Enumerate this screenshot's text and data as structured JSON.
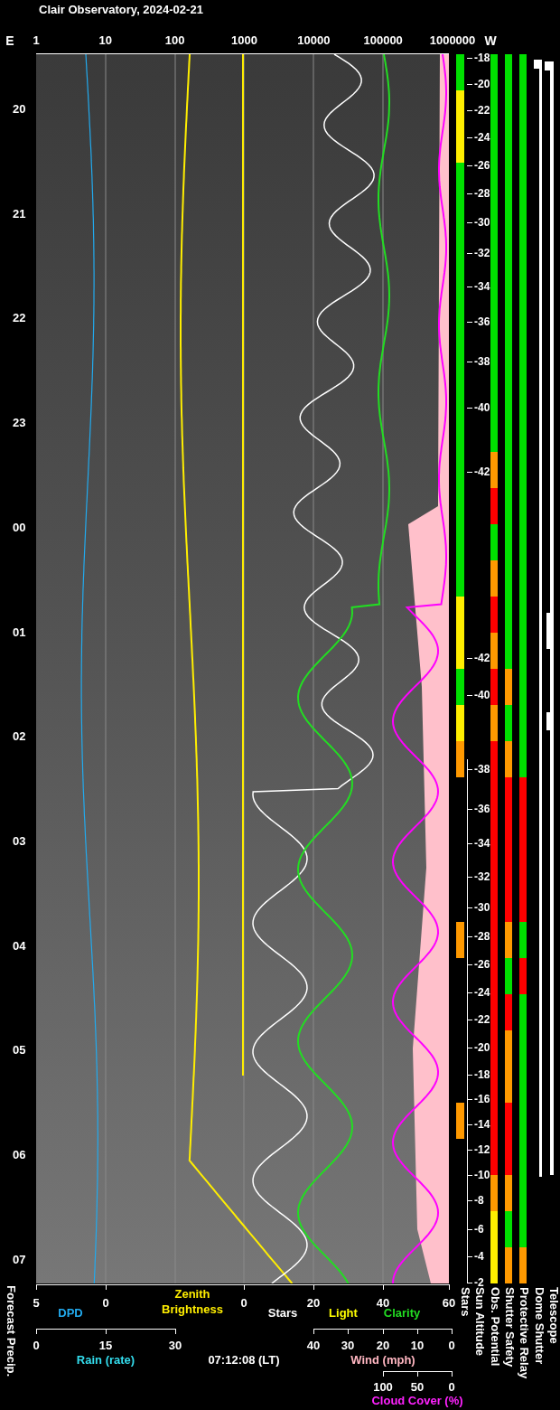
{
  "title": "Clair Observatory, 2024-02-21",
  "top_axis": {
    "left_label": "E",
    "ticks": [
      "1",
      "10",
      "100",
      "1000",
      "10000",
      "100000",
      "1000000"
    ],
    "right_label": "W"
  },
  "time_labels": [
    "20",
    "21",
    "22",
    "23",
    "00",
    "01",
    "02",
    "03",
    "04",
    "05",
    "06",
    "07"
  ],
  "sun_altitude_labels": [
    "-18",
    "-20",
    "-22",
    "-24",
    "-26",
    "-28",
    "-30",
    "-32",
    "-34",
    "-36",
    "-38",
    "-40",
    "-42",
    "-42",
    "-40",
    "-38",
    "-36",
    "-34",
    "-32",
    "-30",
    "-28",
    "-26",
    "-24",
    "-22",
    "-20",
    "-18",
    "-16",
    "-14",
    "-12",
    "-10",
    "-8",
    "-6",
    "-4",
    "-2"
  ],
  "status_bars": [
    {
      "slots": [
        {
          "active": true,
          "color": "#00e000"
        },
        {
          "active": true,
          "color": "#ffee00"
        },
        {
          "active": true,
          "color": "#ffee00"
        },
        {
          "active": true,
          "color": "#00e000"
        },
        {
          "active": true,
          "color": "#00e000"
        },
        {
          "active": true,
          "color": "#00e000"
        },
        {
          "active": true,
          "color": "#00e000"
        },
        {
          "active": true,
          "color": "#00e000"
        },
        {
          "active": true,
          "color": "#00e000"
        },
        {
          "active": true,
          "color": "#00e000"
        },
        {
          "active": true,
          "color": "#00e000"
        },
        {
          "active": true,
          "color": "#00e000"
        },
        {
          "active": true,
          "color": "#00e000"
        },
        {
          "active": true,
          "color": "#00e000"
        },
        {
          "active": true,
          "color": "#00e000"
        },
        {
          "active": true,
          "color": "#ffee00"
        },
        {
          "active": true,
          "color": "#ffee00"
        },
        {
          "active": true,
          "color": "#00e000"
        },
        {
          "active": true,
          "color": "#ffee00"
        },
        {
          "active": true,
          "color": "#ff9900"
        },
        {
          "active": false
        },
        {
          "active": false
        },
        {
          "active": false
        },
        {
          "active": false
        },
        {
          "active": true,
          "color": "#ff9900"
        },
        {
          "active": false
        },
        {
          "active": false
        },
        {
          "active": false
        },
        {
          "active": false
        },
        {
          "active": true,
          "color": "#ff9900"
        },
        {
          "active": false
        },
        {
          "active": false
        },
        {
          "active": false
        },
        {
          "active": false
        }
      ]
    },
    {
      "slots": [
        {
          "color": "#00e000"
        },
        {
          "color": "#00e000"
        },
        {
          "color": "#00e000"
        },
        {
          "color": "#00e000"
        },
        {
          "color": "#00e000"
        },
        {
          "color": "#00e000"
        },
        {
          "color": "#00e000"
        },
        {
          "color": "#00e000"
        },
        {
          "color": "#00e000"
        },
        {
          "color": "#00e000"
        },
        {
          "color": "#00e000"
        },
        {
          "color": "#ff9900"
        },
        {
          "color": "#ff0000"
        },
        {
          "color": "#00e000"
        },
        {
          "color": "#ff9900"
        },
        {
          "color": "#ff0000"
        },
        {
          "color": "#ff9900"
        },
        {
          "color": "#ff0000"
        },
        {
          "color": "#ff9900"
        },
        {
          "color": "#ff0000"
        },
        {
          "color": "#ff0000"
        },
        {
          "color": "#ff0000"
        },
        {
          "color": "#ff0000"
        },
        {
          "color": "#ff0000"
        },
        {
          "color": "#ff0000"
        },
        {
          "color": "#ff0000"
        },
        {
          "color": "#ff0000"
        },
        {
          "color": "#ff0000"
        },
        {
          "color": "#ff0000"
        },
        {
          "color": "#ff0000"
        },
        {
          "color": "#ff0000"
        },
        {
          "color": "#ff9900"
        },
        {
          "color": "#ffee00"
        },
        {
          "color": "#ffee00"
        }
      ]
    },
    {
      "slots": [
        {
          "color": "#00e000"
        },
        {
          "color": "#00e000"
        },
        {
          "color": "#00e000"
        },
        {
          "color": "#00e000"
        },
        {
          "color": "#00e000"
        },
        {
          "color": "#00e000"
        },
        {
          "color": "#00e000"
        },
        {
          "color": "#00e000"
        },
        {
          "color": "#00e000"
        },
        {
          "color": "#00e000"
        },
        {
          "color": "#00e000"
        },
        {
          "color": "#00e000"
        },
        {
          "color": "#00e000"
        },
        {
          "color": "#00e000"
        },
        {
          "color": "#00e000"
        },
        {
          "color": "#00e000"
        },
        {
          "color": "#00e000"
        },
        {
          "color": "#ff9900"
        },
        {
          "color": "#00e000"
        },
        {
          "color": "#ff9900"
        },
        {
          "color": "#ff0000"
        },
        {
          "color": "#ff0000"
        },
        {
          "color": "#ff0000"
        },
        {
          "color": "#ff0000"
        },
        {
          "color": "#ff9900"
        },
        {
          "color": "#00e000"
        },
        {
          "color": "#ff0000"
        },
        {
          "color": "#ff9900"
        },
        {
          "color": "#ff9900"
        },
        {
          "color": "#ff0000"
        },
        {
          "color": "#ff0000"
        },
        {
          "color": "#ff9900"
        },
        {
          "color": "#00e000"
        },
        {
          "color": "#ff9900"
        }
      ]
    },
    {
      "slots": [
        {
          "color": "#00e000"
        },
        {
          "color": "#00e000"
        },
        {
          "color": "#00e000"
        },
        {
          "color": "#00e000"
        },
        {
          "color": "#00e000"
        },
        {
          "color": "#00e000"
        },
        {
          "color": "#00e000"
        },
        {
          "color": "#00e000"
        },
        {
          "color": "#00e000"
        },
        {
          "color": "#00e000"
        },
        {
          "color": "#00e000"
        },
        {
          "color": "#00e000"
        },
        {
          "color": "#00e000"
        },
        {
          "color": "#00e000"
        },
        {
          "color": "#00e000"
        },
        {
          "color": "#00e000"
        },
        {
          "color": "#00e000"
        },
        {
          "color": "#00e000"
        },
        {
          "color": "#00e000"
        },
        {
          "color": "#00e000"
        },
        {
          "color": "#ff0000"
        },
        {
          "color": "#ff0000"
        },
        {
          "color": "#ff0000"
        },
        {
          "color": "#ff0000"
        },
        {
          "color": "#00e000"
        },
        {
          "color": "#ff0000"
        },
        {
          "color": "#00e000"
        },
        {
          "color": "#00e000"
        },
        {
          "color": "#00e000"
        },
        {
          "color": "#00e000"
        },
        {
          "color": "#00e000"
        },
        {
          "color": "#00e000"
        },
        {
          "color": "#00e000"
        },
        {
          "color": "#ff9900"
        }
      ]
    }
  ],
  "bottom_axes": {
    "dpd": {
      "ticks": [
        "5",
        "0"
      ],
      "label": "DPD"
    },
    "zenith_brightness": {
      "label_lines": [
        "Zenith",
        "Brightness"
      ]
    },
    "stars_light_clarity": {
      "ticks": [
        "0",
        "20",
        "40",
        "60"
      ],
      "labels": [
        {
          "kind": "stars",
          "text": "Stars"
        },
        {
          "kind": "light",
          "text": "Light"
        },
        {
          "kind": "clarity",
          "text": "Clarity"
        }
      ]
    },
    "rain": {
      "ticks": [
        "0",
        "15",
        "30"
      ],
      "label": "Rain (rate)"
    },
    "time": "07:12:08 (LT)",
    "wind": {
      "ticks": [
        "40",
        "30",
        "20",
        "10",
        "0"
      ],
      "label": "Wind (mph)"
    },
    "cloud_cover": {
      "ticks": [
        "100",
        "50",
        "0"
      ],
      "label": "Cloud Cover (%)"
    }
  },
  "left_label": "Forecast Precip.",
  "column_labels": [
    "Stars",
    "Sun Altitude",
    "Obs. Potential",
    "Shutter Safety",
    "Protective Relay",
    "Dome Shutter",
    "Telescope"
  ]
}
